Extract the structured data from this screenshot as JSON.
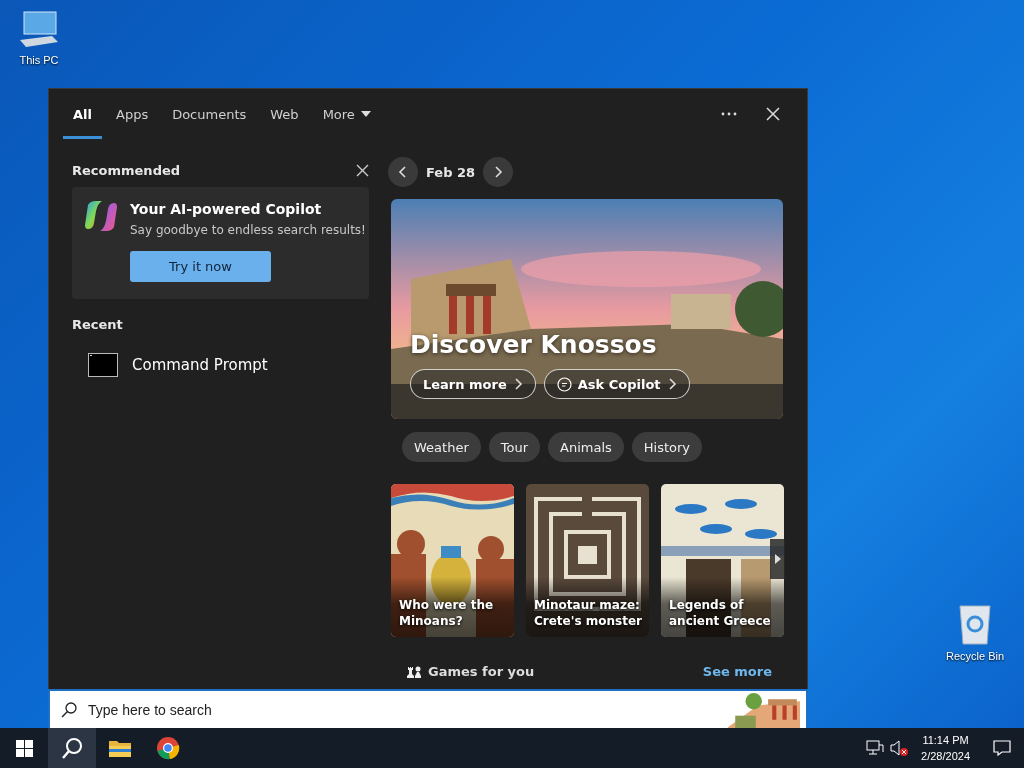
{
  "desktop_icons": [
    {
      "label": "This PC",
      "kind": "computer"
    },
    {
      "label": "Recycle Bin",
      "kind": "bin"
    }
  ],
  "search_panel": {
    "tabs": [
      {
        "label": "All",
        "selected": true
      },
      {
        "label": "Apps",
        "selected": false
      },
      {
        "label": "Documents",
        "selected": false
      },
      {
        "label": "Web",
        "selected": false
      },
      {
        "label": "More",
        "selected": false,
        "kind": "dropdown"
      }
    ],
    "recommended": {
      "heading": "Recommended",
      "title": "Your AI-powered Copilot",
      "text": "Say goodbye to endless search results!",
      "button": "Try it now"
    },
    "recent": {
      "heading": "Recent",
      "items": [
        {
          "label": "Command Prompt",
          "kind": "terminal"
        }
      ]
    },
    "date_label": "Feb 28",
    "hero": {
      "title": "Discover Knossos",
      "kind": "picture",
      "buttons": [
        {
          "label": "Learn more",
          "kind": "plain"
        },
        {
          "label": "Ask Copilot",
          "kind": "chat"
        }
      ]
    },
    "chips": [
      "Weather",
      "Tour",
      "Animals",
      "History"
    ],
    "cards": [
      {
        "title": "Who were the Minoans?",
        "kind": "picture"
      },
      {
        "title": "Minotaur maze: Crete's monster",
        "kind": "picture"
      },
      {
        "title": "Legends of ancient Greece",
        "kind": "picture"
      }
    ],
    "games": {
      "label": "Games for you",
      "link": "See more"
    }
  },
  "search_box": {
    "placeholder": "Type here to search"
  },
  "taskbar": {
    "apps": [
      {
        "kind": "start",
        "selected": false
      },
      {
        "kind": "search",
        "selected": true
      },
      {
        "kind": "explorer",
        "selected": false
      },
      {
        "kind": "chrome",
        "selected": false
      }
    ],
    "tray": [
      {
        "kind": "network"
      },
      {
        "kind": "volume-muted"
      }
    ],
    "time": "11:14 PM",
    "date": "2/28/2024"
  }
}
